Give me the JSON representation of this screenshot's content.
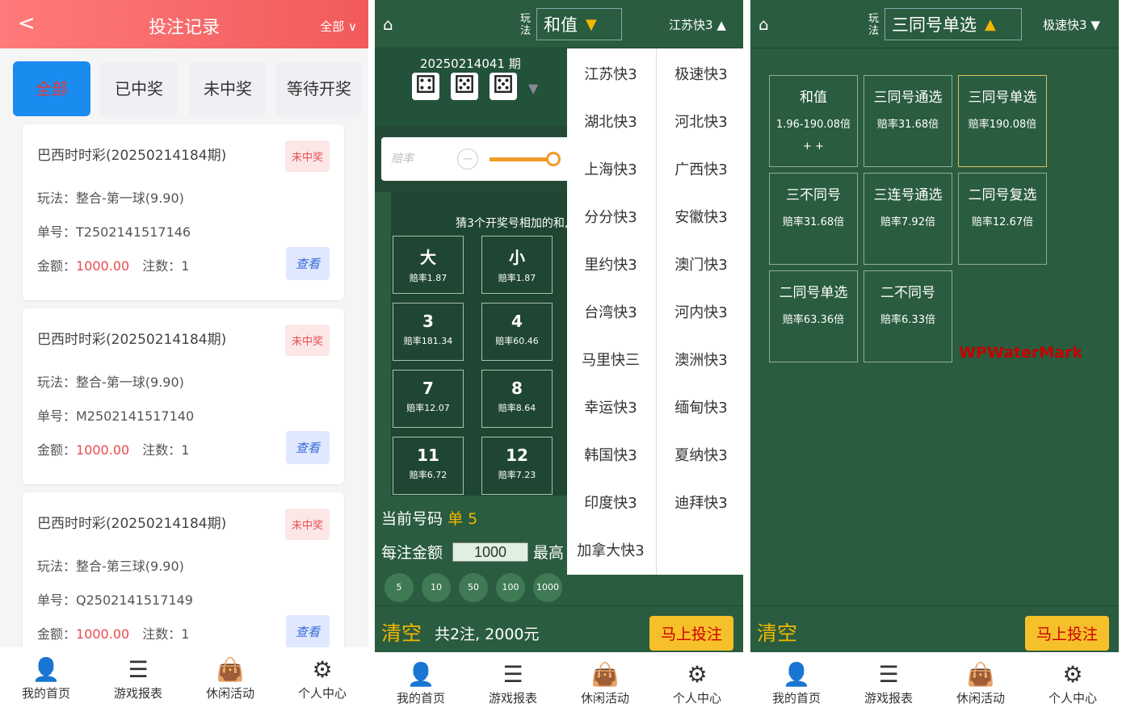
{
  "p1": {
    "back": "<",
    "title": "投注记录",
    "filter": "全部",
    "filter_arrow": "chevron-down",
    "tabs": [
      "全部",
      "已中奖",
      "未中奖",
      "等待开奖"
    ],
    "cards": [
      {
        "title": "巴西时时彩(20250214184期)",
        "badge": "未中奖",
        "play": "玩法：整合-第一球(9.90)",
        "order": "单号：T2502141517146",
        "amount_label": "金额：",
        "amount": "1000.00",
        "count": "注数：1",
        "view": "查看"
      },
      {
        "title": "巴西时时彩(20250214184期)",
        "badge": "未中奖",
        "play": "玩法：整合-第一球(9.90)",
        "order": "单号：M2502141517140",
        "amount_label": "金额：",
        "amount": "1000.00",
        "count": "注数：1",
        "view": "查看"
      },
      {
        "title": "巴西时时彩(20250214184期)",
        "badge": "未中奖",
        "play": "玩法：整合-第三球(9.90)",
        "order": "单号：Q2502141517149",
        "amount_label": "金额：",
        "amount": "1000.00",
        "count": "注数：1",
        "view": "查看"
      }
    ]
  },
  "tabbar": [
    "我的首页",
    "游戏报表",
    "休闲活动",
    "个人中心"
  ],
  "p2": {
    "wf1": "玩",
    "wf2": "法",
    "play": "和值",
    "game": "江苏快3",
    "issue": "20250214041 期",
    "odd_placeholder": "赔率",
    "hint": "猜3个开奖号相加的和,",
    "cells": [
      {
        "n": "大",
        "o": "赔率1.87"
      },
      {
        "n": "小",
        "o": "赔率1.87"
      },
      {
        "n": "3",
        "o": "赔率181.34"
      },
      {
        "n": "4",
        "o": "赔率60.46"
      },
      {
        "n": "7",
        "o": "赔率12.07"
      },
      {
        "n": "8",
        "o": "赔率8.64"
      },
      {
        "n": "11",
        "o": "赔率6.72"
      },
      {
        "n": "12",
        "o": "赔率7.23"
      }
    ],
    "current_label": "当前号码",
    "current_value": "单 5",
    "bet_label": "每注金额",
    "bet_value": "1000",
    "max_label": "最高",
    "chips": [
      "5",
      "10",
      "50",
      "100",
      "1000"
    ],
    "clear": "清空",
    "total": "共2注, 2000元",
    "bet_btn": "马上投注",
    "dropdown_left": [
      "江苏快3",
      "湖北快3",
      "上海快3",
      "分分快3",
      "里约快3",
      "台湾快3",
      "马里快三",
      "幸运快3",
      "韩国快3",
      "印度快3",
      "加拿大快3"
    ],
    "dropdown_right": [
      "极速快3",
      "河北快3",
      "广西快3",
      "安徽快3",
      "澳门快3",
      "河内快3",
      "澳洲快3",
      "缅甸快3",
      "夏纳快3",
      "迪拜快3"
    ]
  },
  "p3": {
    "wf1": "玩",
    "wf2": "法",
    "play": "三同号单选",
    "game": "极速快3",
    "cells": [
      {
        "n": "和值",
        "o": "1.96-190.08倍",
        "extra": "+ +"
      },
      {
        "n": "三同号通选",
        "o": "赔率31.68倍"
      },
      {
        "n": "三同号单选",
        "o": "赔率190.08倍"
      },
      {
        "n": "三不同号",
        "o": "赔率31.68倍"
      },
      {
        "n": "三连号通选",
        "o": "赔率7.92倍"
      },
      {
        "n": "二同号复选",
        "o": "赔率12.67倍"
      },
      {
        "n": "二同号单选",
        "o": "赔率63.36倍"
      },
      {
        "n": "二不同号",
        "o": "赔率6.33倍"
      }
    ],
    "watermark": "WPWaterMark",
    "clear": "清空",
    "bet_btn": "马上投注"
  }
}
